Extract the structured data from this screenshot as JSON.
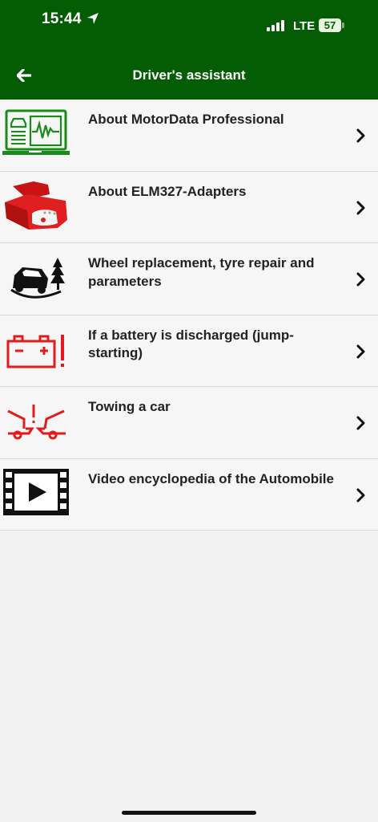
{
  "status_bar": {
    "time": "15:44",
    "network": "LTE",
    "battery": "57"
  },
  "header": {
    "title": "Driver's assistant",
    "back_icon": "back-arrow-icon",
    "background_color": "#045d04"
  },
  "menu": {
    "items": [
      {
        "label": "About MotorData Professional",
        "icon": "laptop-diagnostics-icon"
      },
      {
        "label": "About ELM327-Adapters",
        "icon": "obd-adapter-icon"
      },
      {
        "label": "Wheel replacement, tyre repair and parameters",
        "icon": "car-in-ditch-icon"
      },
      {
        "label": "If a battery is discharged (jump-starting)",
        "icon": "battery-warning-icon"
      },
      {
        "label": "Towing a car",
        "icon": "towing-icon"
      },
      {
        "label": "Video encyclopedia of the Automobile",
        "icon": "video-film-icon"
      }
    ]
  },
  "colors": {
    "accent_green": "#045d04",
    "icon_green": "#1a8a1a",
    "icon_red": "#e01b1b"
  }
}
